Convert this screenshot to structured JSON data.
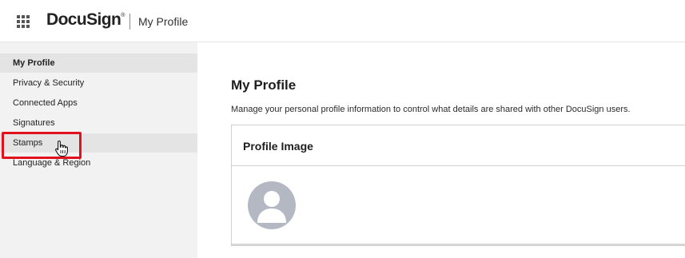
{
  "header": {
    "apps_icon": "apps-grid-icon",
    "logo_text": "DocuSign",
    "logo_mark": "®",
    "title": "My Profile"
  },
  "sidebar": {
    "items": [
      {
        "label": "My Profile",
        "active": true
      },
      {
        "label": "Privacy & Security",
        "active": false
      },
      {
        "label": "Connected Apps",
        "active": false
      },
      {
        "label": "Signatures",
        "active": false
      },
      {
        "label": "Stamps",
        "active": false,
        "hovered": true
      },
      {
        "label": "Language & Region",
        "active": false
      }
    ],
    "cursor_icon": "hand-pointer-icon"
  },
  "main": {
    "title": "My Profile",
    "description": "Manage your personal profile information to control what details are shared with other DocuSign users.",
    "card": {
      "title": "Profile Image",
      "avatar_icon": "default-user-avatar-icon"
    }
  },
  "colors": {
    "sidebar_bg": "#f2f2f2",
    "active_item_bg": "#e4e4e4",
    "highlight_border": "#e1121e",
    "avatar_bg": "#b3b8c3"
  }
}
